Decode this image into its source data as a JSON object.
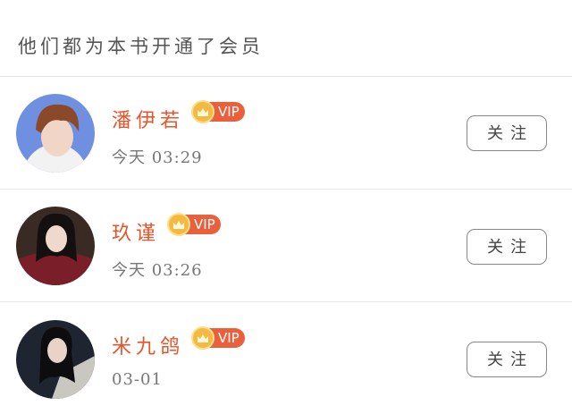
{
  "header": {
    "title": "他们都为本书开通了会员"
  },
  "members": [
    {
      "name": "潘伊若",
      "badge": "VIP",
      "time": "今天 03:29",
      "follow_label": "关注"
    },
    {
      "name": "玖谨",
      "badge": "VIP",
      "time": "今天 03:26",
      "follow_label": "关注"
    },
    {
      "name": "米九鸽",
      "badge": "VIP",
      "time": "03-01",
      "follow_label": "关注"
    }
  ],
  "colors": {
    "name": "#e8552b",
    "vip_badge": "#e8603c",
    "crown": "#f4b942",
    "divider": "#e6e6e6"
  },
  "icons": [
    "avatar",
    "crown-icon"
  ]
}
